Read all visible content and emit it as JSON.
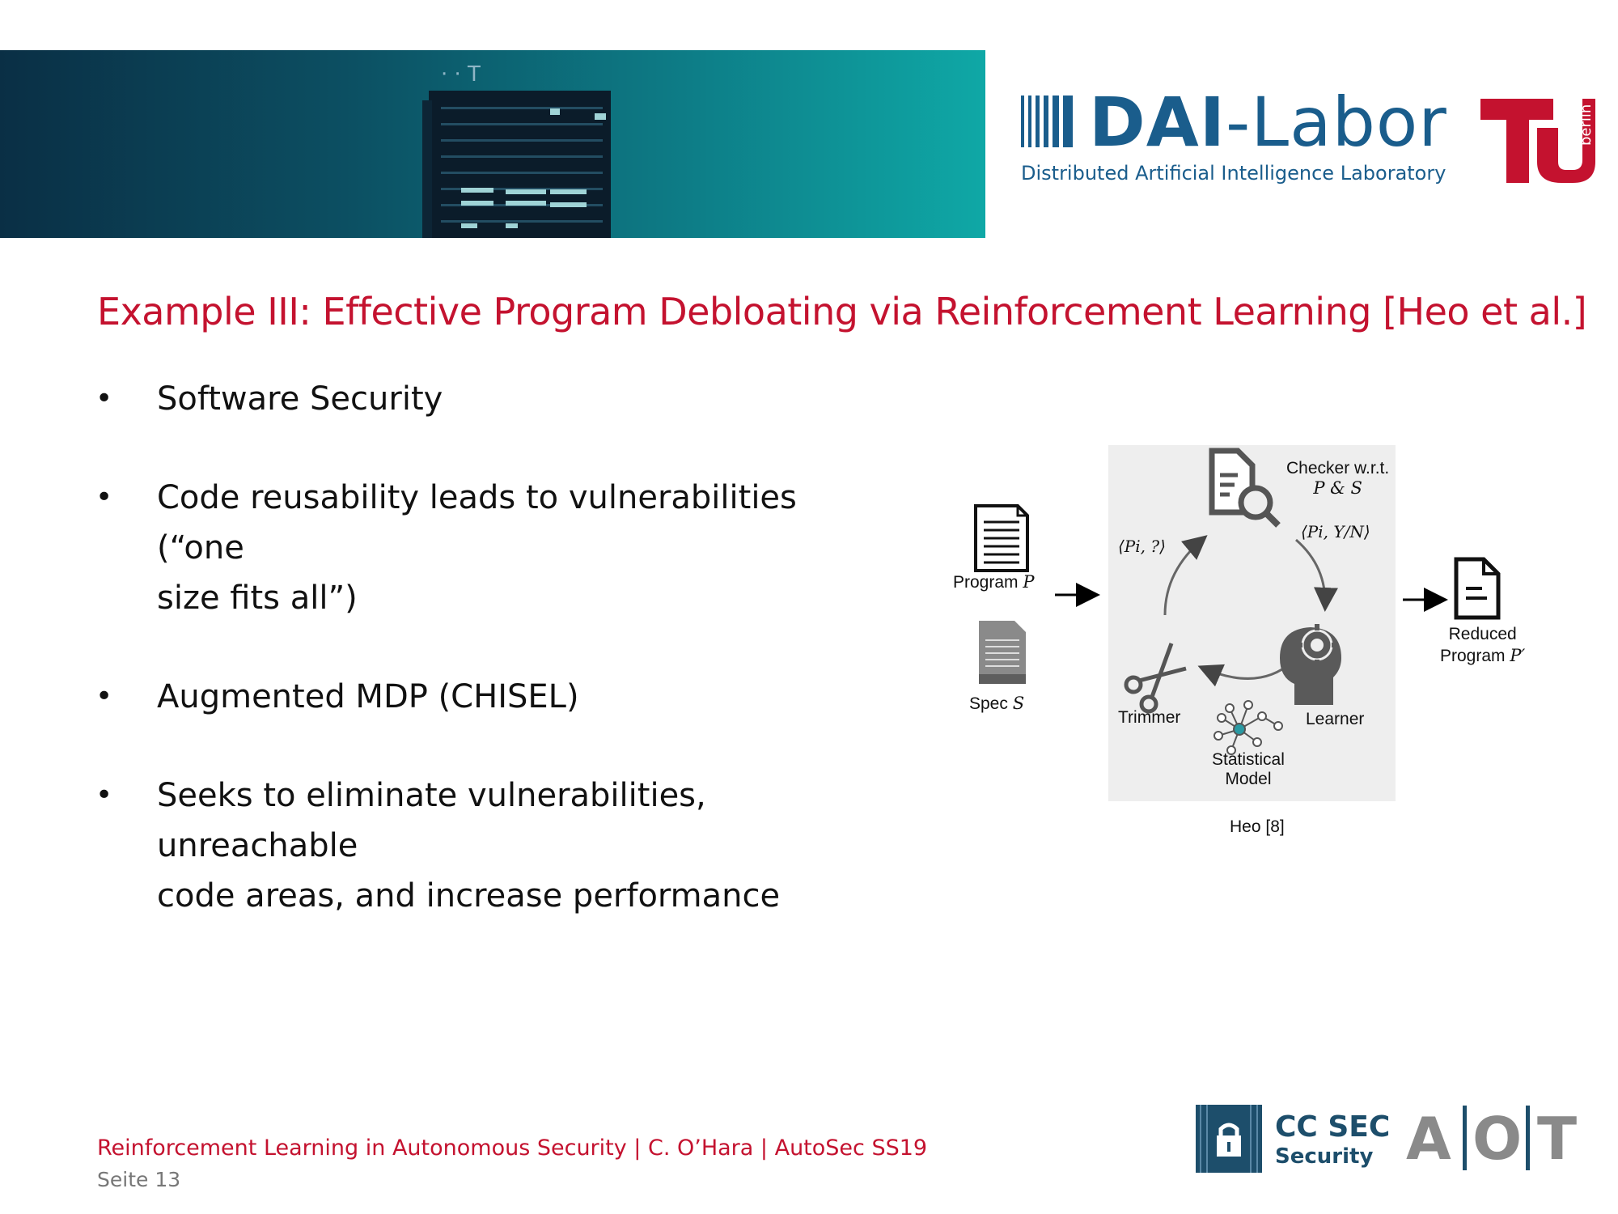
{
  "header": {
    "logo_title_bold": "DAI",
    "logo_title_rest": "-Labor",
    "logo_subtitle": "Distributed Artificial Intelligence Laboratory",
    "tu_logo_text": "berlin"
  },
  "slide": {
    "title": "Example III: Effective Program Debloating via Reinforcement Learning [Heo et al.]",
    "bullets": [
      {
        "line1": "Software Security",
        "line2": ""
      },
      {
        "line1": "Code reusability leads to vulnerabilities (“one",
        "line2": "size fits all”)"
      },
      {
        "line1": "Augmented MDP (CHISEL)",
        "line2": ""
      },
      {
        "line1": "Seeks to eliminate vulnerabilities, unreachable",
        "line2": "code areas, and increase performance"
      }
    ]
  },
  "figure": {
    "program_label": "Program",
    "program_var": "P",
    "spec_label": "Spec",
    "spec_var": "S",
    "checker_label": "Checker w.r.t.",
    "checker_vars": "P & S",
    "query_label": "⟨Pi, ?⟩",
    "answer_label": "⟨Pi, Y/N⟩",
    "trimmer_label": "Trimmer",
    "learner_label": "Learner",
    "model_label_1": "Statistical",
    "model_label_2": "Model",
    "reduced_label_1": "Reduced",
    "reduced_label_2": "Program",
    "reduced_var": "P′",
    "caption": "Heo [8]"
  },
  "footer": {
    "line1": "Reinforcement Learning in Autonomous Security | C. O’Hara | AutoSec SS19",
    "line2": "Seite 13",
    "ccsec_title": "CC SEC",
    "ccsec_sub": "Security",
    "aot_letters": [
      "A",
      "O",
      "T"
    ]
  },
  "colors": {
    "accent_red": "#c4122f",
    "dai_blue": "#1a5d8c",
    "banner_dark": "#0a2f45",
    "banner_light": "#0fa8a6"
  }
}
